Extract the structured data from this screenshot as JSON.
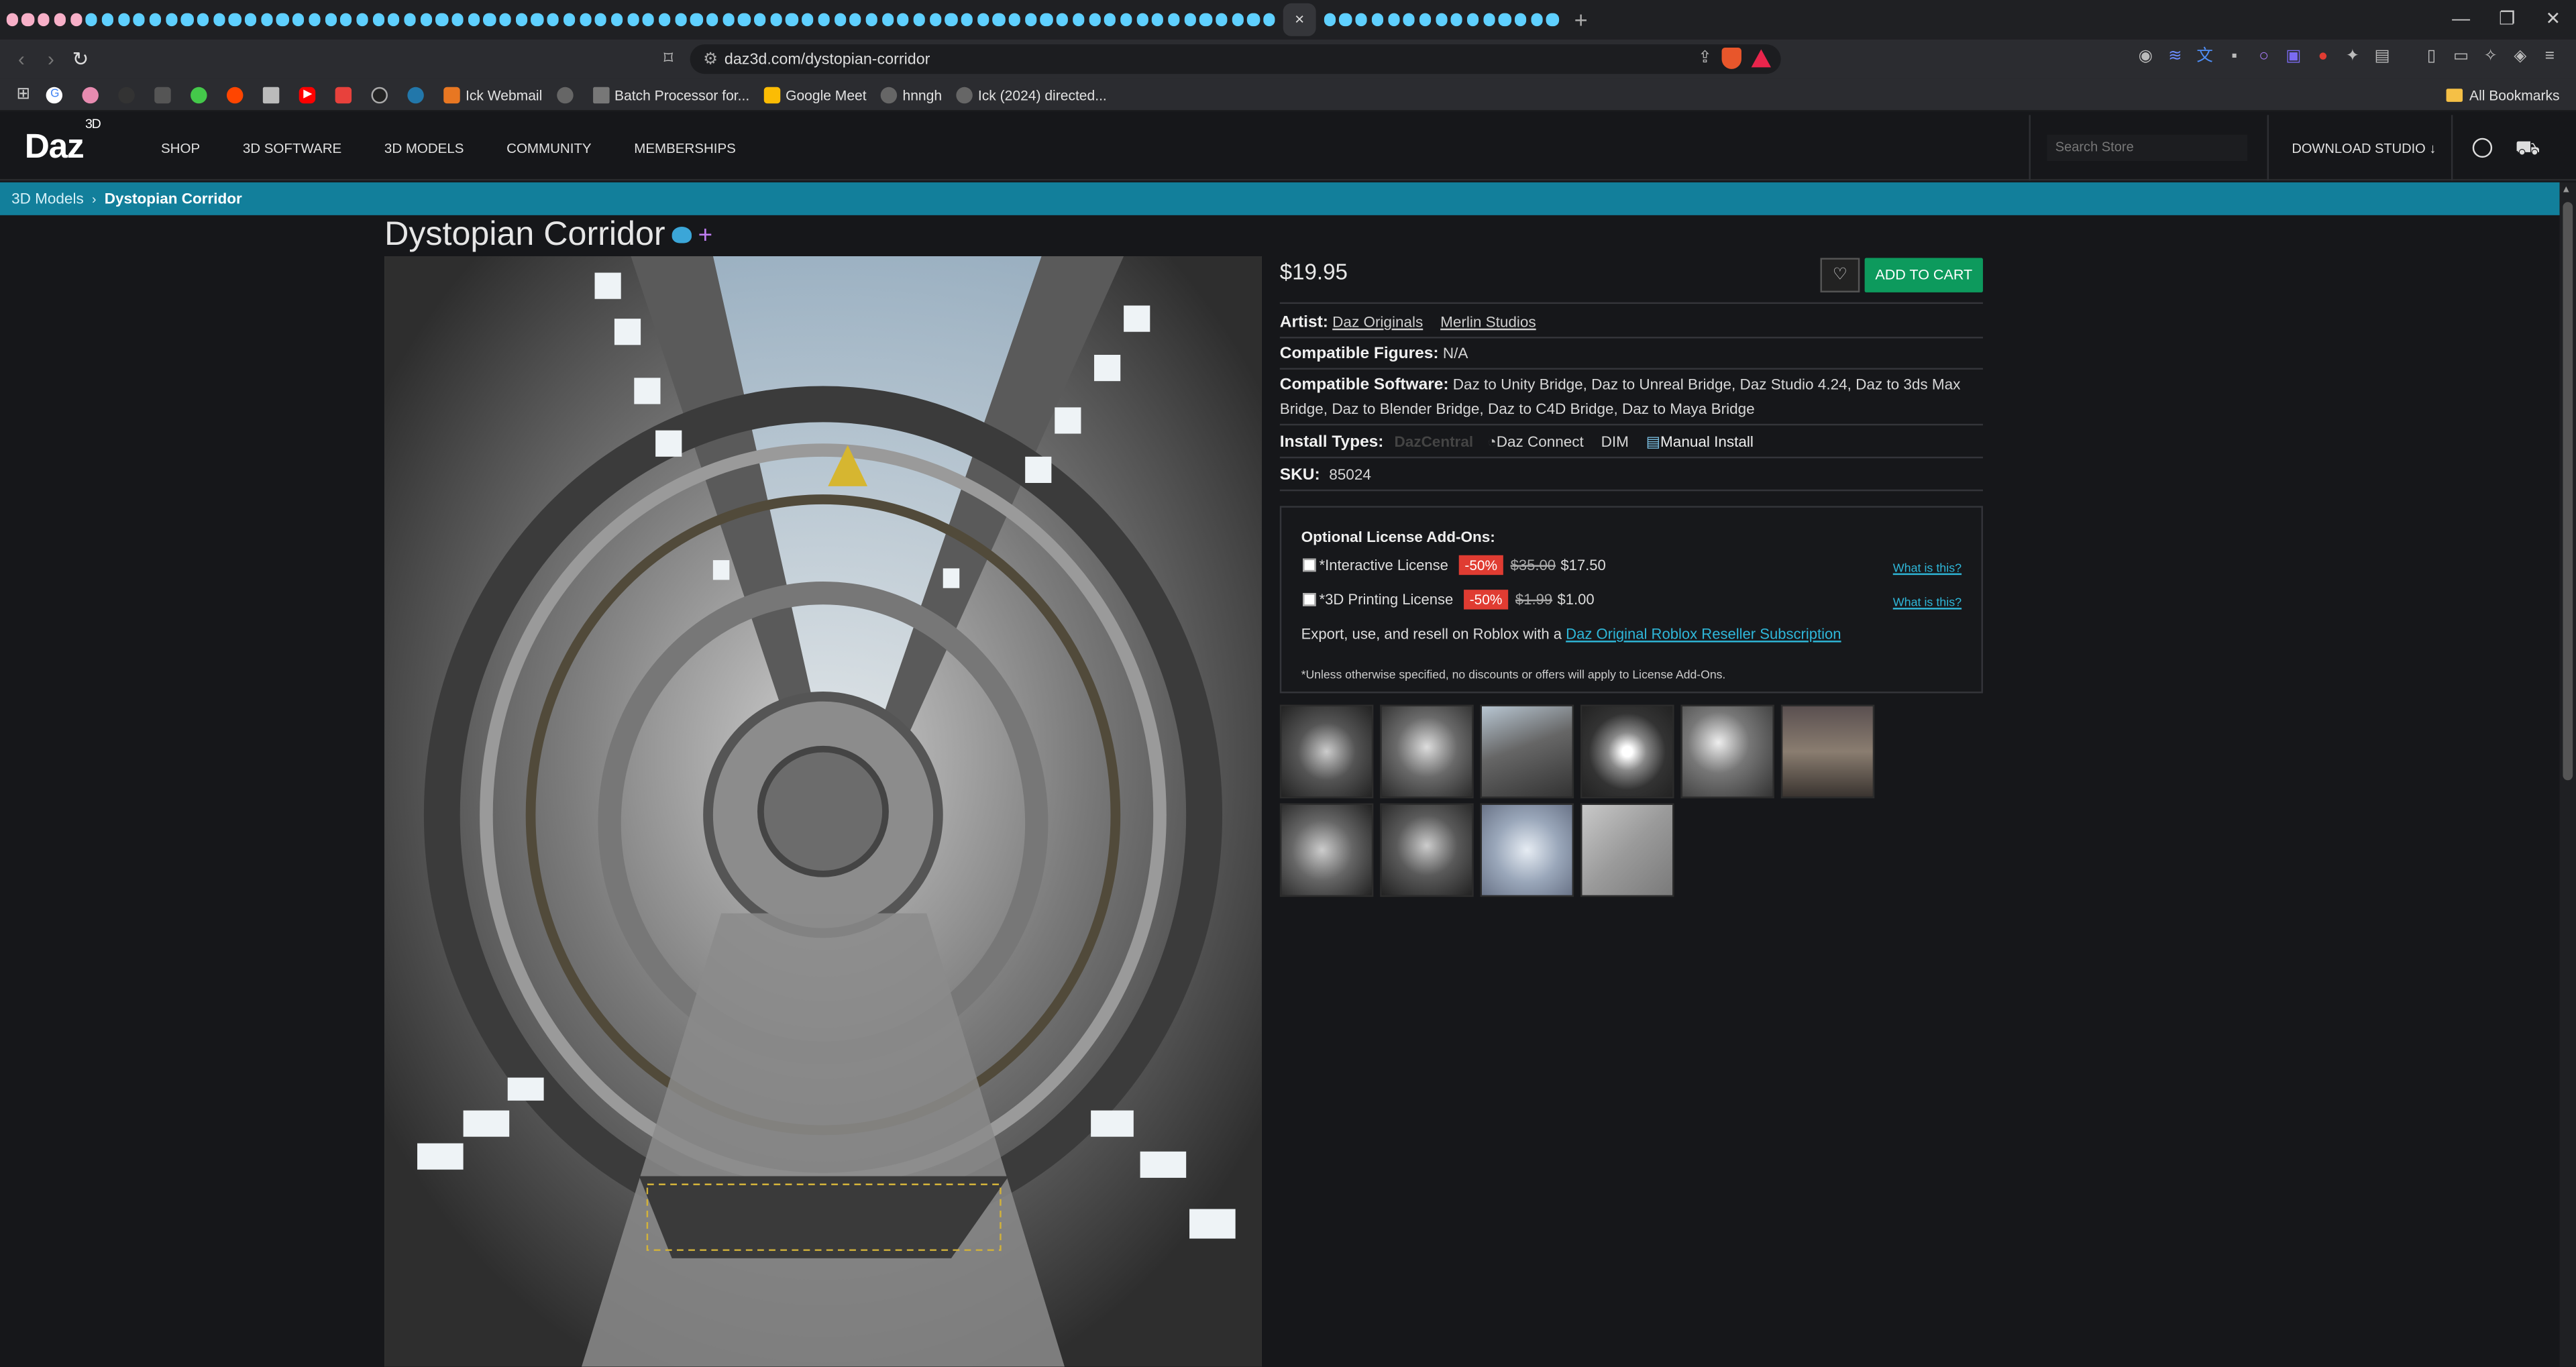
{
  "browser": {
    "url": "daz3d.com/dystopian-corridor",
    "bookmarks": [
      "Ick Webmail",
      "Batch Processor for...",
      "Google Meet",
      "hnngh",
      "Ick (2024) directed..."
    ],
    "all_bookmarks": "All Bookmarks",
    "close_tab": "×",
    "new_tab": "+"
  },
  "site": {
    "logo": "Daz",
    "logo_sup": "3D",
    "nav": [
      "SHOP",
      "3D SOFTWARE",
      "3D MODELS",
      "COMMUNITY",
      "MEMBERSHIPS"
    ],
    "search_placeholder": "Search Store",
    "download_studio": "DOWNLOAD STUDIO ↓"
  },
  "breadcrumb": {
    "parent": "3D Models",
    "separator": "›",
    "current": "Dystopian Corridor"
  },
  "product": {
    "title": "Dystopian Corridor",
    "price": "$19.95",
    "favorite_icon": "♡",
    "add_to_cart": "ADD TO CART",
    "artist_label": "Artist:",
    "artists": [
      "Daz Originals",
      "Merlin Studios"
    ],
    "figures_label": "Compatible Figures:",
    "figures_value": "N/A",
    "software_label": "Compatible Software:",
    "software_value": "Daz to Unity Bridge, Daz to Unreal Bridge, Daz Studio 4.24, Daz to 3ds Max Bridge, Daz to Blender Bridge, Daz to C4D Bridge, Daz to Maya Bridge",
    "install_label": "Install Types:",
    "install_types": [
      "DazCentral",
      "Daz Connect",
      "DIM",
      "Manual Install"
    ],
    "sku_label": "SKU:",
    "sku_value": "85024"
  },
  "addons": {
    "heading": "Optional License Add-Ons:",
    "licenses": [
      {
        "name": "*Interactive License",
        "discount": "-50%",
        "old_price": "$35.00",
        "new_price": "$17.50",
        "help": "What is this?"
      },
      {
        "name": "*3D Printing License",
        "discount": "-50%",
        "old_price": "$1.99",
        "new_price": "$1.00",
        "help": "What is this?"
      }
    ],
    "roblox_text": "Export, use, and resell on Roblox with a",
    "roblox_link": "Daz Original Roblox Reseller Subscription",
    "note": "*Unless otherwise specified, no discounts or offers will apply to License Add-Ons."
  },
  "colors": {
    "accent_teal": "#127f9b",
    "cart_green": "#0d9a5d",
    "discount_red": "#e03c32",
    "link_blue": "#2fb7d9"
  }
}
